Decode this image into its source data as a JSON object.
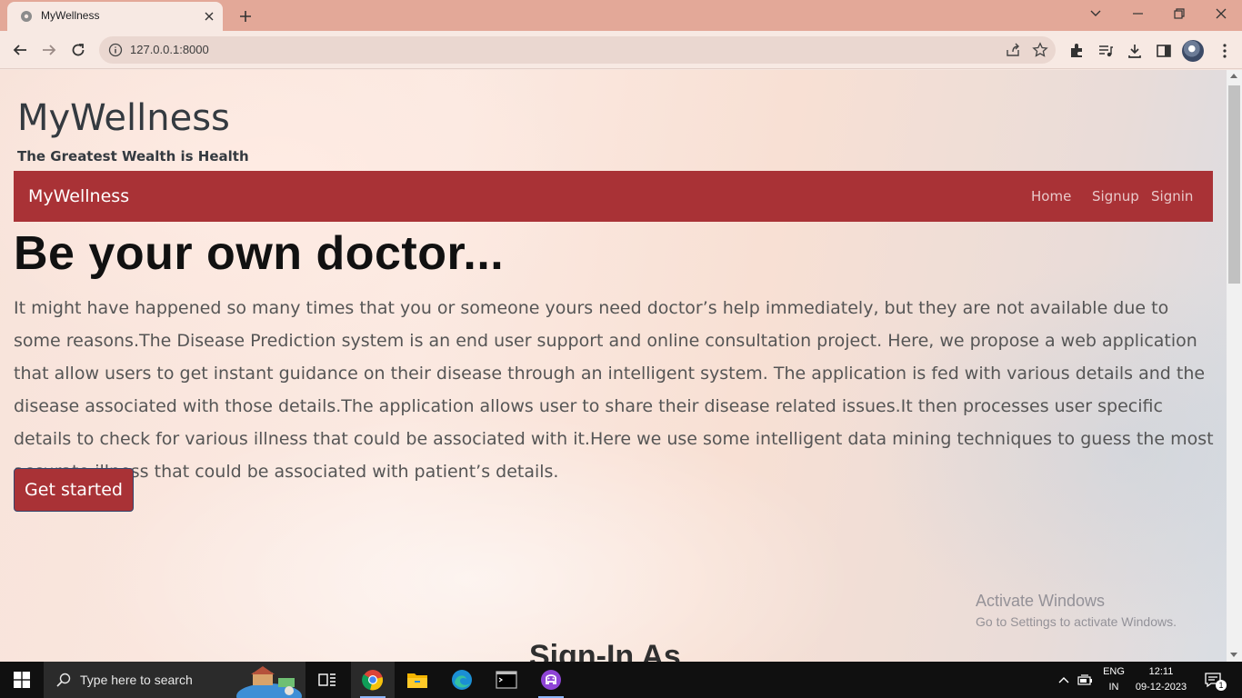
{
  "browser": {
    "tab_title": "MyWellness",
    "url": "127.0.0.1:8000"
  },
  "site": {
    "brand_title": "MyWellness",
    "tagline": "The Greatest Wealth is Health",
    "navbar": {
      "brand": "MyWellness",
      "links": [
        "Home",
        "Signup",
        "Signin"
      ]
    },
    "hero": {
      "title": "Be your own doctor...",
      "text": "It might have happened so many times that you or someone yours need doctor’s help immediately, but they are not available due to some reasons.The Disease Prediction system is an end user support and online consultation project. Here, we propose a web application that allow users to get instant guidance on their disease through an intelligent system. The application is fed with various details and the disease associated with those details.The application allows user to share their disease related issues.It then processes user specific details to check for various illness that could be associated with it.Here we use some intelligent data mining techniques to guess the most accurate illness that could be associated with patient’s details.",
      "button": "Get started"
    },
    "next_section_title": "Sign-In As"
  },
  "watermark": {
    "line1": "Activate Windows",
    "line2": "Go to Settings to activate Windows."
  },
  "taskbar": {
    "search_placeholder": "Type here to search",
    "language": "ENG",
    "region": "IN",
    "time": "12:11",
    "date": "09-12-2023",
    "notification_count": "1"
  },
  "colors": {
    "navbar": "#a93236",
    "button": "#a93236",
    "tabstrip": "#e3a898"
  }
}
